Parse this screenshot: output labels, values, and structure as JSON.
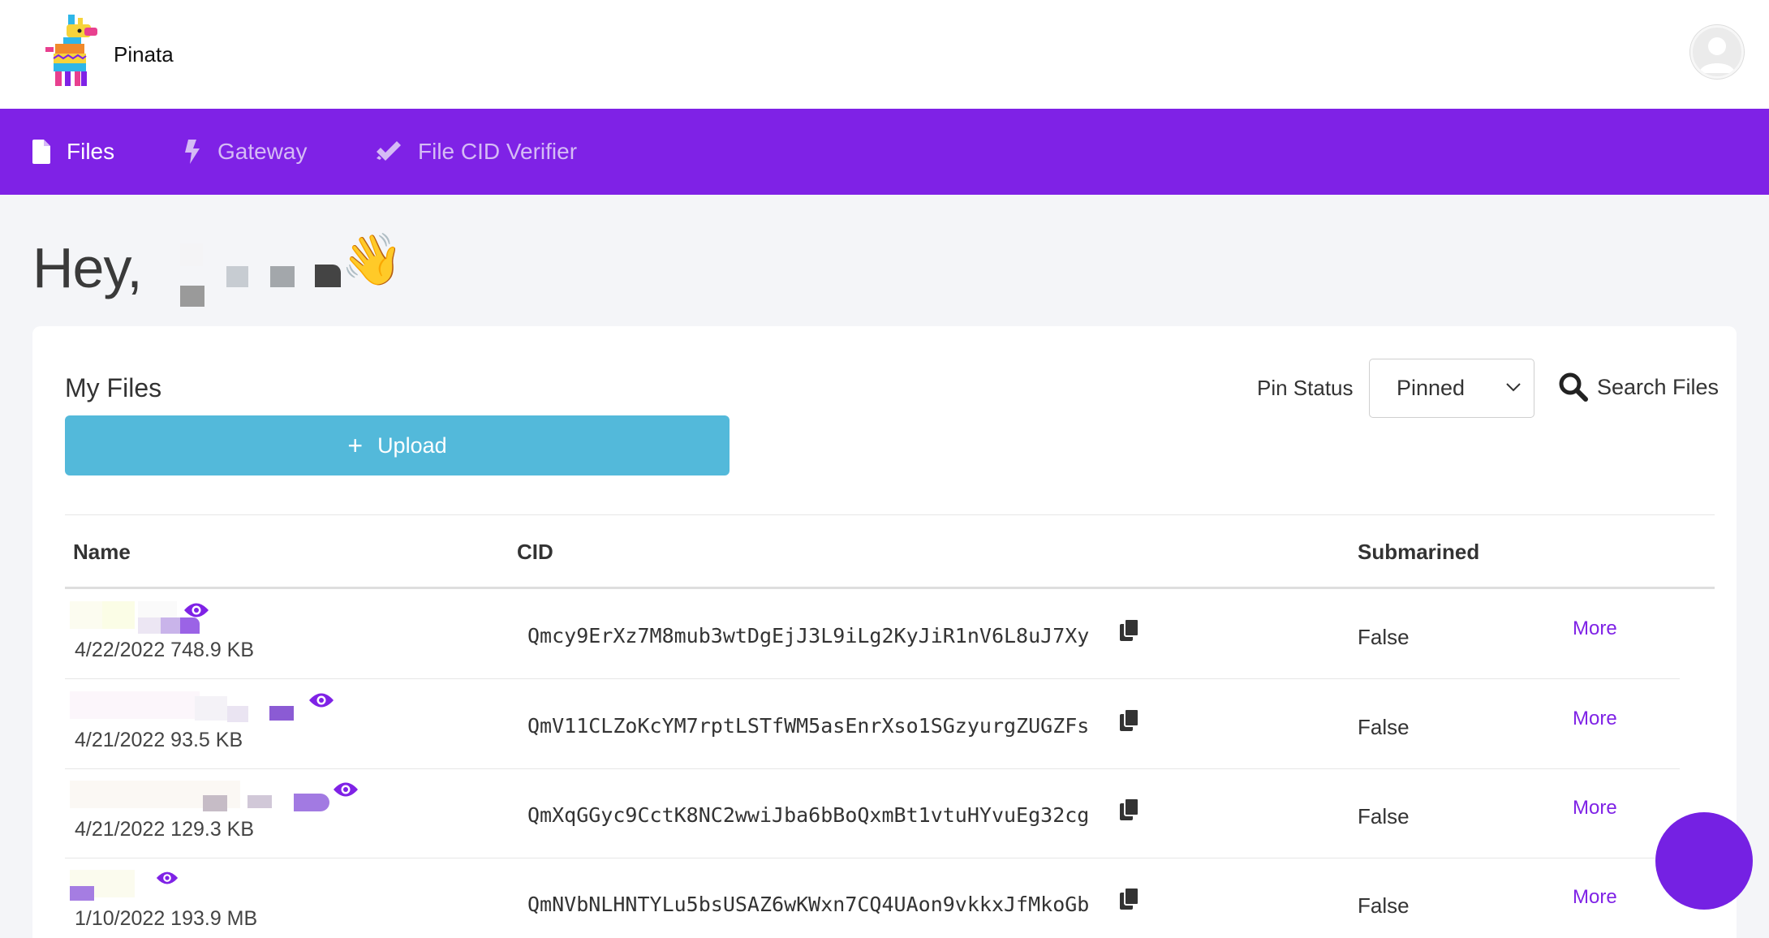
{
  "header": {
    "brand": "Pinata",
    "logo_icon": "pinata-llama-logo",
    "avatar_icon": "user-avatar-icon"
  },
  "nav": {
    "items": [
      {
        "label": "Files",
        "icon": "file-icon",
        "active": true
      },
      {
        "label": "Gateway",
        "icon": "bolt-icon",
        "active": false
      },
      {
        "label": "File CID Verifier",
        "icon": "double-check-icon",
        "active": false
      }
    ]
  },
  "greeting": {
    "text": "Hey,",
    "emoji": "👋"
  },
  "files_panel": {
    "title": "My Files",
    "upload_label": "Upload",
    "pin_status_label": "Pin Status",
    "pin_status_value": "Pinned",
    "search_label": "Search Files"
  },
  "table": {
    "headers": [
      "Name",
      "CID",
      "Submarined"
    ],
    "rows": [
      {
        "meta": "4/22/2022 748.9 KB",
        "cid": "Qmcy9ErXz7M8mub3wtDgEjJ3L9iLg2KyJiR1nV6L8uJ7Xy",
        "submarined": "False",
        "more": "More"
      },
      {
        "meta": "4/21/2022 93.5 KB",
        "cid": "QmV11CLZoKcYM7rptLSTfWM5asEnrXso1SGzyurgZUGZFs",
        "submarined": "False",
        "more": "More"
      },
      {
        "meta": "4/21/2022 129.3 KB",
        "cid": "QmXqGGyc9CctK8NC2wwiJba6bBoQxmBt1vtuHYvuEg32cg",
        "submarined": "False",
        "more": "More"
      },
      {
        "meta": "1/10/2022 193.9 MB",
        "cid": "QmNVbNLHNTYLu5bsUSAZ6wKWxn7CQ4UAon9vkkxJfMkoGb",
        "submarined": "False",
        "more": "More"
      }
    ]
  },
  "colors": {
    "brand_purple": "#7f22e6",
    "upload_blue": "#53b9da",
    "chat_purple": "#7521e3"
  }
}
